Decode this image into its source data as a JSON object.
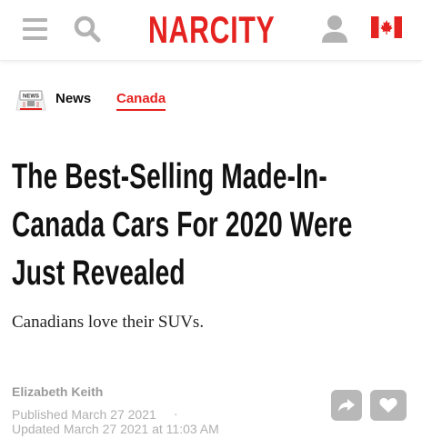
{
  "header": {
    "logo_text": "NARCITY",
    "icons": {
      "menu": "hamburger-menu-icon",
      "search": "search-icon",
      "account": "user-icon",
      "region": "canada-flag-icon"
    }
  },
  "colors": {
    "brand": "#e42320",
    "text": "#111111",
    "muted": "#9a9a9a",
    "button_bg": "#b8b8b8"
  },
  "category": {
    "icon": "news-icon",
    "primary": "News",
    "secondary": "Canada"
  },
  "article": {
    "headline": "The Best-Selling Made-In-Canada Cars For 2020 Were Just Revealed",
    "subheadline": "Canadians love their SUVs.",
    "author": "Elizabeth Keith",
    "published": "Published March 27 2021",
    "separator": "·",
    "updated": "Updated March 27 2021 at 11:03 AM"
  },
  "actions": {
    "share_icon": "share-icon",
    "like_icon": "heart-icon"
  }
}
